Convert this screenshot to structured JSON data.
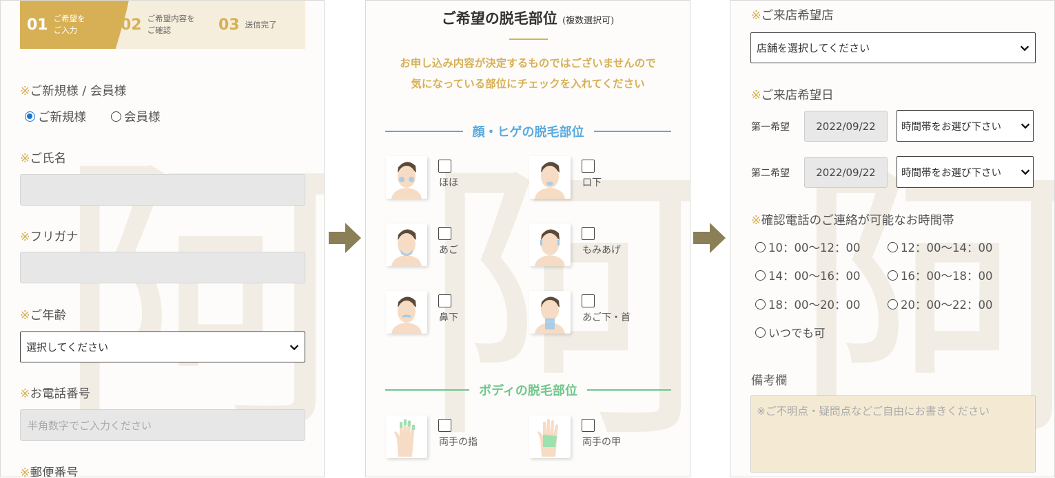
{
  "colors": {
    "gold": "#d7b056",
    "face_section": "#5aaae0",
    "body_section": "#6fc68a",
    "arrow": "#8a7f56"
  },
  "steps": [
    {
      "num": "01",
      "label": "ご希望を\nご入力"
    },
    {
      "num": "02",
      "label": "ご希望内容を\nご確認"
    },
    {
      "num": "03",
      "label": "送信完了"
    }
  ],
  "form1": {
    "member": {
      "mark": "※",
      "label": "ご新規様 / 会員様",
      "options": [
        "ご新規様",
        "会員様"
      ],
      "selected": "ご新規様"
    },
    "name": {
      "mark": "※",
      "label": "ご氏名",
      "value": ""
    },
    "furigana": {
      "mark": "※",
      "label": "フリガナ",
      "value": ""
    },
    "age": {
      "mark": "※",
      "label": "ご年齢",
      "selected": "選択してください"
    },
    "phone": {
      "mark": "※",
      "label": "お電話番号",
      "placeholder": "半角数字でご入力ください"
    },
    "postal": {
      "mark": "※",
      "label": "郵便番号"
    }
  },
  "parts": {
    "title": "ご希望の脱毛部位",
    "title_note": "(複数選択可)",
    "intro_line1": "お申し込み内容が決定するものではございませんので",
    "intro_line2": "気になっている部位にチェックを入れてください",
    "face_heading": "顔・ヒゲの脱毛部位",
    "face_items": [
      {
        "label": "ほほ",
        "icon": "face-cheek-icon"
      },
      {
        "label": "口下",
        "icon": "face-under-mouth-icon"
      },
      {
        "label": "あご",
        "icon": "face-chin-icon"
      },
      {
        "label": "もみあげ",
        "icon": "face-sideburn-icon"
      },
      {
        "label": "鼻下",
        "icon": "face-under-nose-icon"
      },
      {
        "label": "あご下・首",
        "icon": "face-neck-icon"
      }
    ],
    "body_heading": "ボディの脱毛部位",
    "body_items": [
      {
        "label": "両手の指",
        "icon": "hand-fingers-icon"
      },
      {
        "label": "両手の甲",
        "icon": "hand-back-icon"
      }
    ]
  },
  "form3": {
    "store": {
      "mark": "※",
      "label": "ご来店希望店",
      "selected": "店舗を選択してください"
    },
    "visit_date": {
      "mark": "※",
      "label": "ご来店希望日",
      "first_label": "第一希望",
      "first_date": "2022/09/22",
      "first_time": "時間帯をお選び下さい",
      "second_label": "第二希望",
      "second_date": "2022/09/22",
      "second_time": "時間帯をお選び下さい"
    },
    "call_time": {
      "mark": "※",
      "label": "確認電話のご連絡が可能なお時間帯",
      "options": [
        "10：00〜12：00",
        "12：00〜14：00",
        "14：00〜16：00",
        "16：00〜18：00",
        "18：00〜20：00",
        "20：00〜22：00",
        "いつでも可"
      ]
    },
    "remarks": {
      "label": "備考欄",
      "placeholder": "※ご不明点・疑問点などご自由にお書きください"
    }
  }
}
